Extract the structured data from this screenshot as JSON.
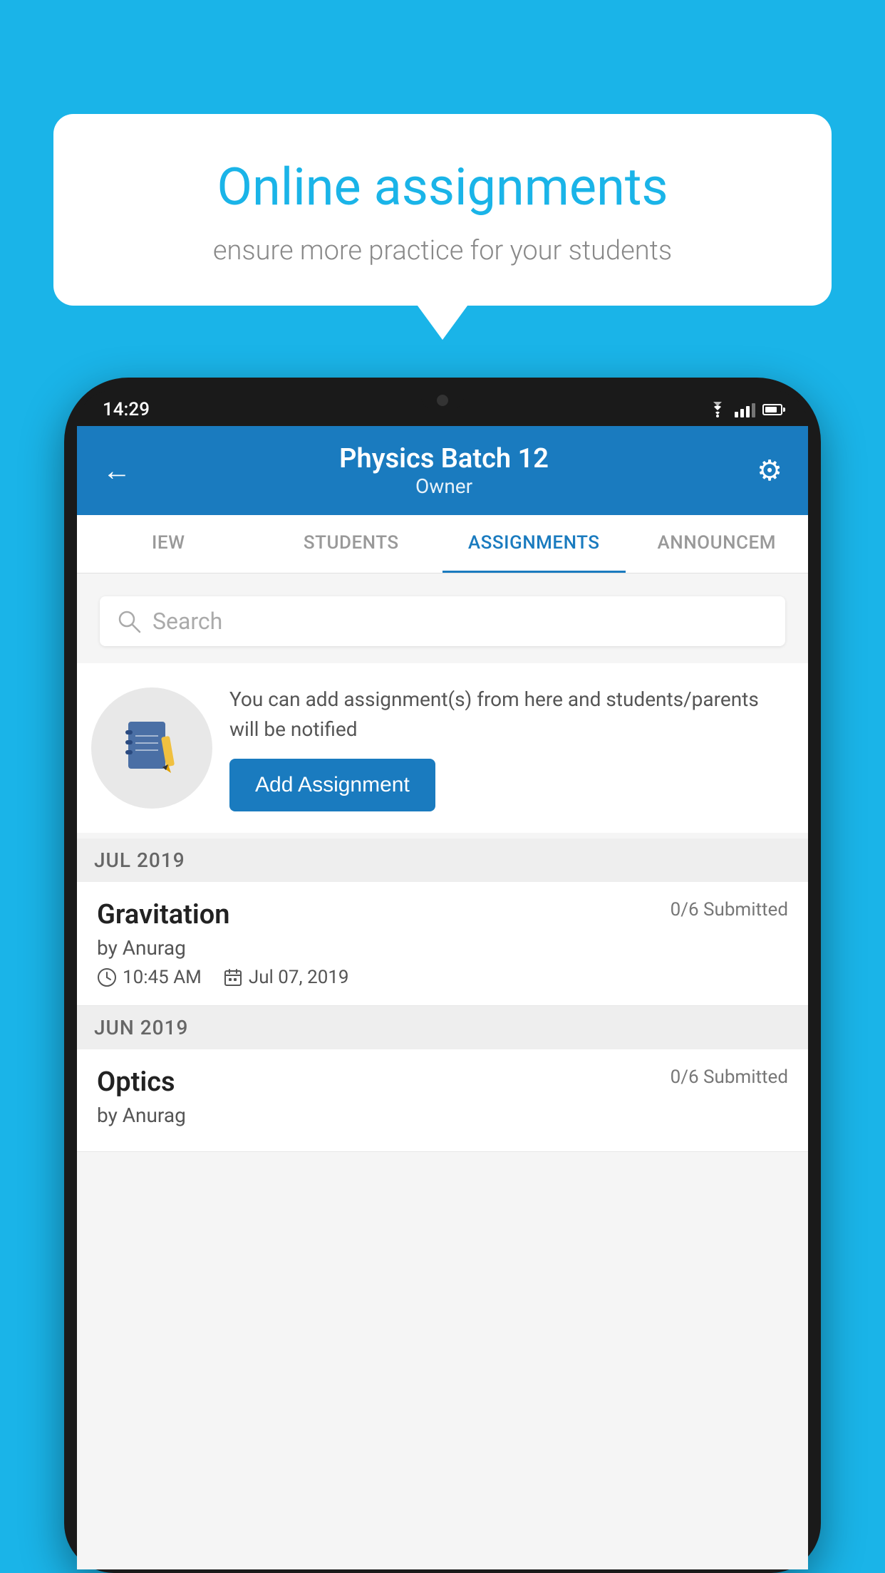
{
  "background_color": "#1ab4e8",
  "promo": {
    "title": "Online assignments",
    "subtitle": "ensure more practice for your students"
  },
  "phone": {
    "time": "14:29",
    "status": {
      "wifi": "▾",
      "signal": "▲",
      "battery": "▮"
    }
  },
  "app": {
    "header": {
      "title": "Physics Batch 12",
      "subtitle": "Owner",
      "back_label": "←",
      "settings_label": "⚙"
    },
    "tabs": [
      {
        "label": "IEW",
        "active": false
      },
      {
        "label": "STUDENTS",
        "active": false
      },
      {
        "label": "ASSIGNMENTS",
        "active": true
      },
      {
        "label": "ANNOUNCEM",
        "active": false
      }
    ],
    "search": {
      "placeholder": "Search"
    },
    "empty_state": {
      "description": "You can add assignment(s) from here and students/parents will be notified",
      "button_label": "Add Assignment"
    },
    "sections": [
      {
        "month_label": "JUL 2019",
        "assignments": [
          {
            "name": "Gravitation",
            "submitted": "0/6 Submitted",
            "author": "by Anurag",
            "time": "10:45 AM",
            "date": "Jul 07, 2019"
          }
        ]
      },
      {
        "month_label": "JUN 2019",
        "assignments": [
          {
            "name": "Optics",
            "submitted": "0/6 Submitted",
            "author": "by Anurag",
            "time": "",
            "date": ""
          }
        ]
      }
    ]
  }
}
